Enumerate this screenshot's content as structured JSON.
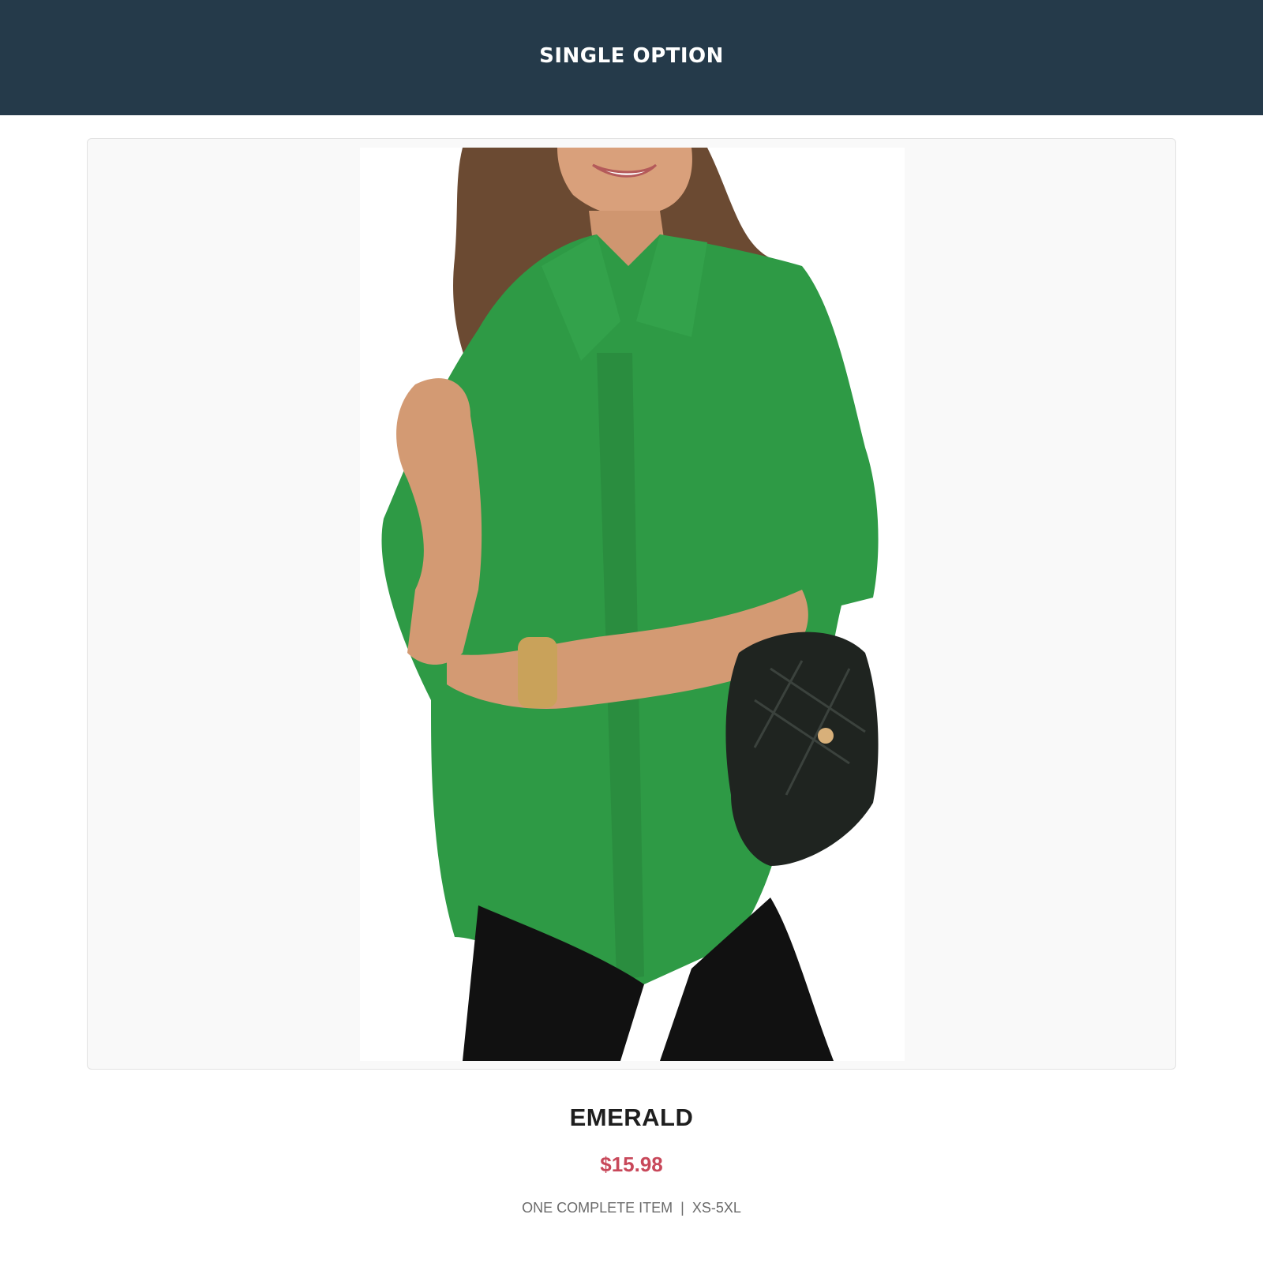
{
  "header": {
    "title": "SINGLE OPTION"
  },
  "product": {
    "image_alt": "Woman in emerald green short-sleeve button-up blouse with black quilted shoulder bag",
    "name": "EMERALD",
    "price": "$15.98",
    "detail": "ONE COMPLETE ITEM",
    "separator": "|",
    "sizes": "XS-5XL"
  },
  "colors": {
    "header_bg": "#253a4a",
    "price": "#c8485a",
    "shirt": "#2e9a45"
  }
}
